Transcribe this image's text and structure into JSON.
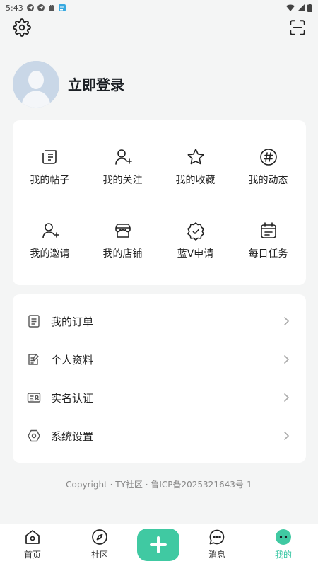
{
  "status_bar": {
    "time": "5:43"
  },
  "profile": {
    "login_label": "立即登录"
  },
  "grid": [
    {
      "label": "我的帖子",
      "icon": "post-icon"
    },
    {
      "label": "我的关注",
      "icon": "follow-icon"
    },
    {
      "label": "我的收藏",
      "icon": "star-icon"
    },
    {
      "label": "我的动态",
      "icon": "hashtag-icon"
    },
    {
      "label": "我的邀请",
      "icon": "invite-icon"
    },
    {
      "label": "我的店铺",
      "icon": "shop-icon"
    },
    {
      "label": "蓝V申请",
      "icon": "verified-badge-icon"
    },
    {
      "label": "每日任务",
      "icon": "calendar-icon"
    }
  ],
  "menu": [
    {
      "label": "我的订单",
      "icon": "order-icon"
    },
    {
      "label": "个人资料",
      "icon": "edit-profile-icon"
    },
    {
      "label": "实名认证",
      "icon": "id-card-icon"
    },
    {
      "label": "系统设置",
      "icon": "hexagon-settings-icon"
    }
  ],
  "footer": {
    "copyright": "Copyright · TY社区 · 鲁ICP备2025321643号-1"
  },
  "bottom_nav": {
    "home": "首页",
    "community": "社区",
    "messages": "消息",
    "mine": "我的"
  },
  "colors": {
    "accent": "#40c9a2",
    "active_tab": "#36c6a3",
    "background": "#f4f5f5"
  }
}
